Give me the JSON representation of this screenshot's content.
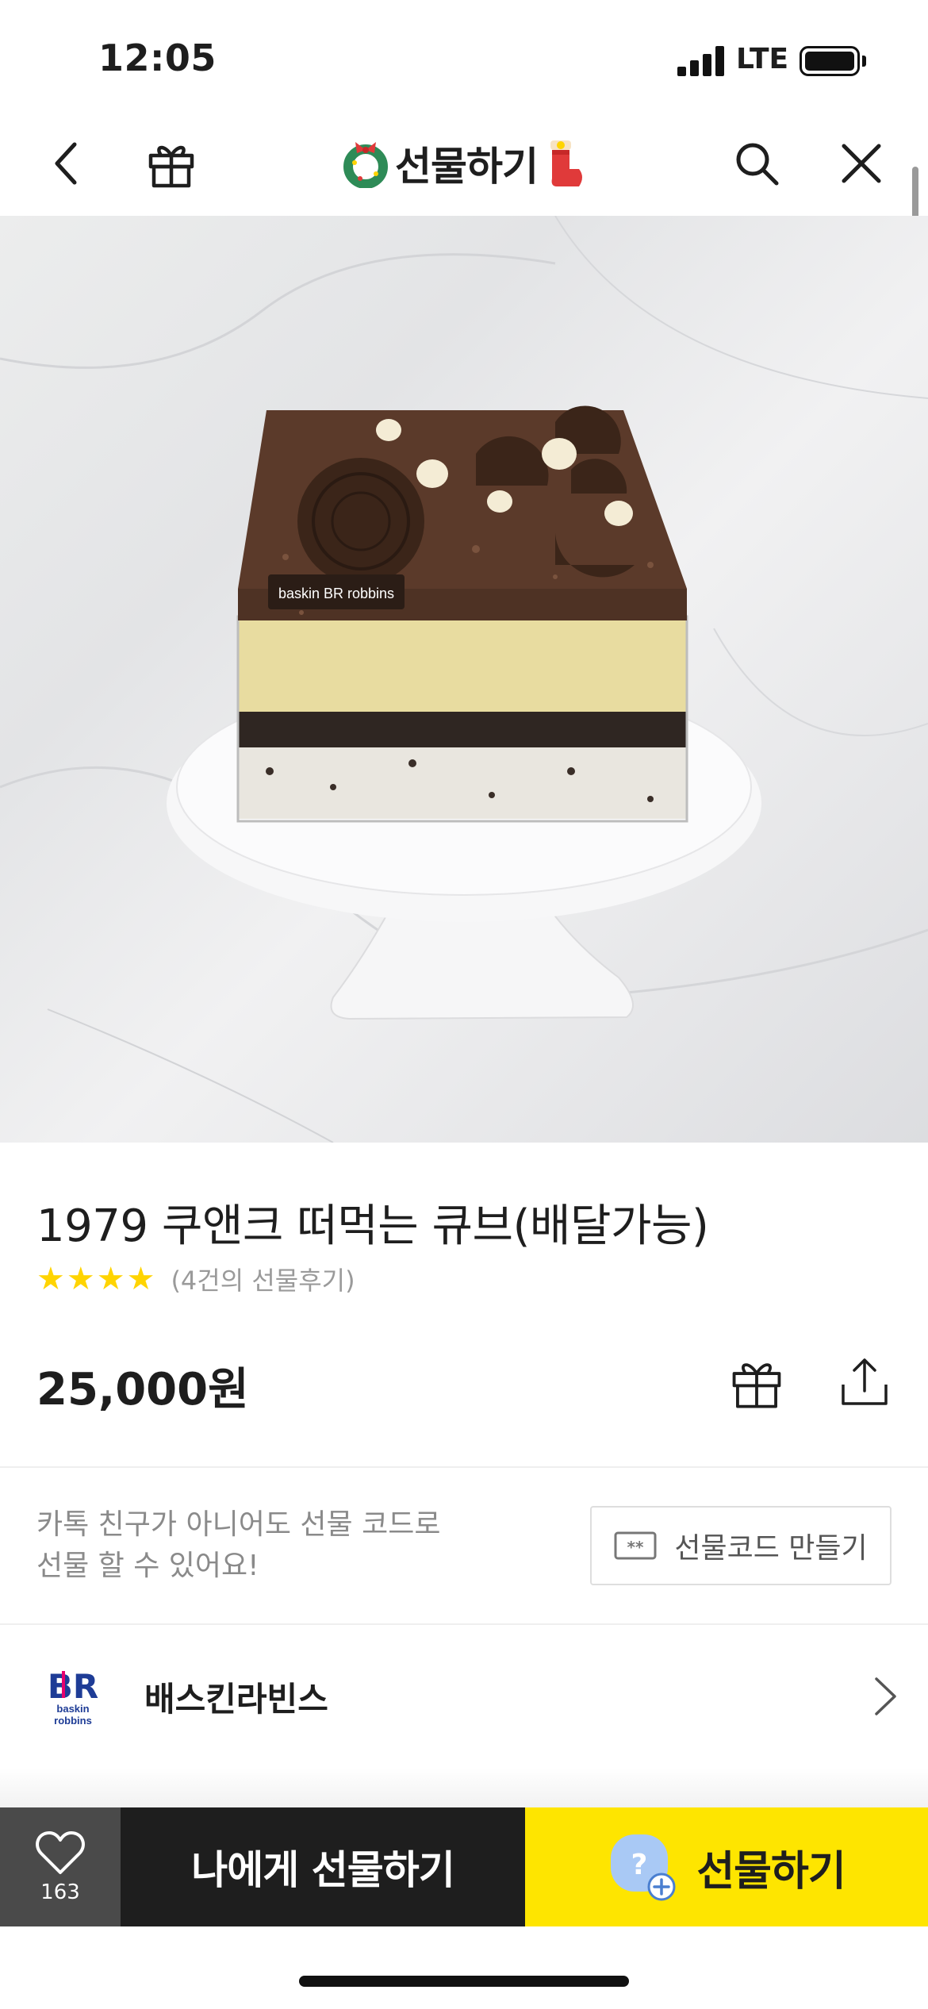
{
  "status_bar": {
    "time": "12:05",
    "network": "LTE"
  },
  "nav": {
    "title": "선물하기",
    "icons": [
      "back-icon",
      "gift-box-icon",
      "wreath-icon",
      "stocking-icon",
      "search-icon",
      "close-icon"
    ]
  },
  "hero": {
    "brand_badge": "baskin BR robbins"
  },
  "product": {
    "title": "1979 쿠앤크 떠먹는 큐브(배달가능)",
    "rating_stars": 4,
    "review_count_text": "(4건의 선물후기)",
    "price_value": "25,000",
    "price_unit": "원"
  },
  "gift_code": {
    "line1": "카톡 친구가 아니어도 선물 코드로",
    "line2": "선물 할 수 있어요!",
    "button_label": "선물코드 만들기",
    "button_icon_text": "**"
  },
  "brand": {
    "name": "배스킨라빈스",
    "logo_text": "BR"
  },
  "bottom_bar": {
    "like_count": "163",
    "self_gift_label": "나에게 선물하기",
    "gift_label": "선물하기",
    "friend_icon_text": "?"
  },
  "colors": {
    "accent_yellow": "#fee500",
    "star_yellow": "#ffd400",
    "dark": "#1e1e1e",
    "like_bg": "#4a4a4a",
    "brand_blue": "#1e3c96",
    "brand_pink": "#e6006e"
  }
}
